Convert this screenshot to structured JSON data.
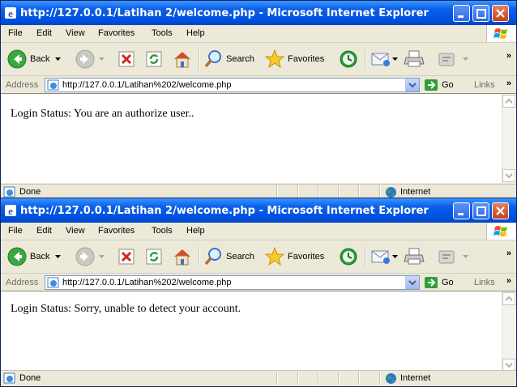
{
  "windows": [
    {
      "title": "http://127.0.0.1/Latihan 2/welcome.php - Microsoft Internet Explorer",
      "menu": [
        "File",
        "Edit",
        "View",
        "Favorites",
        "Tools",
        "Help"
      ],
      "toolbar": {
        "back": "Back",
        "search": "Search",
        "favorites": "Favorites"
      },
      "address": {
        "label": "Address",
        "url": "http://127.0.0.1/Latihan%202/welcome.php",
        "go": "Go",
        "links": "Links"
      },
      "content": {
        "message": "Login Status: You are an authorize user.."
      },
      "status": {
        "text": "Done",
        "zone": "Internet"
      }
    },
    {
      "title": "http://127.0.0.1/Latihan 2/welcome.php - Microsoft Internet Explorer",
      "menu": [
        "File",
        "Edit",
        "View",
        "Favorites",
        "Tools",
        "Help"
      ],
      "toolbar": {
        "back": "Back",
        "search": "Search",
        "favorites": "Favorites"
      },
      "address": {
        "label": "Address",
        "url": "http://127.0.0.1/Latihan%202/welcome.php",
        "go": "Go",
        "links": "Links"
      },
      "content": {
        "message": "Login Status: Sorry, unable to detect your account."
      },
      "status": {
        "text": "Done",
        "zone": "Internet"
      }
    }
  ],
  "chevron": "»",
  "colors": {
    "titlebar": "#0054e3",
    "chrome": "#ece9d8",
    "address_border": "#7f9db9"
  }
}
